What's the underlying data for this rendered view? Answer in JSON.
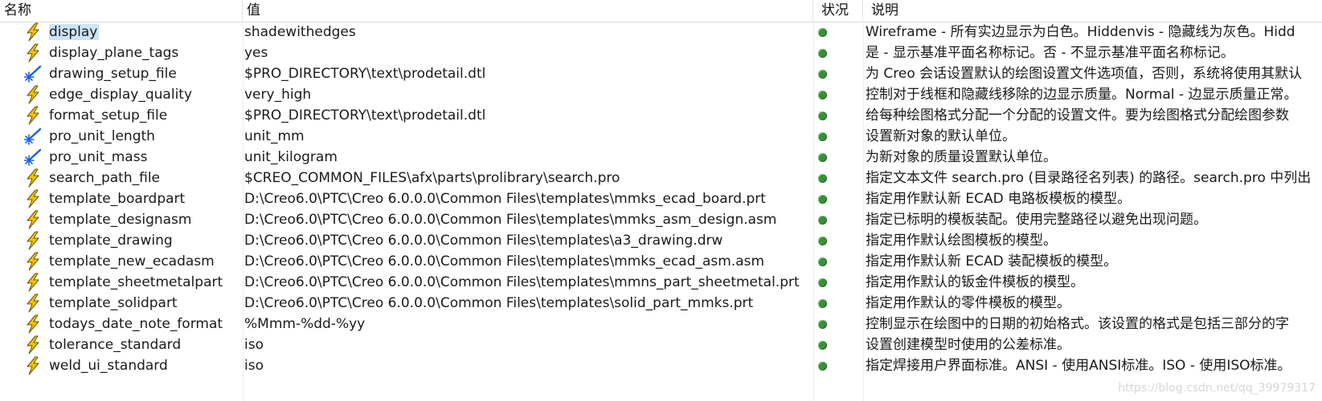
{
  "header": {
    "name": "名称",
    "value": "值",
    "status": "状况",
    "description": "说明"
  },
  "rows": [
    {
      "icon": "lightning-icon",
      "name": "display",
      "value": "shadewithedges",
      "status": "active",
      "description": "Wireframe - 所有实边显示为白色。Hiddenvis - 隐藏线为灰色。Hidd"
    },
    {
      "icon": "lightning-icon",
      "name": "display_plane_tags",
      "value": "yes",
      "status": "active",
      "description": "是 - 显示基准平面名称标记。否 - 不显示基准平面名称标记。"
    },
    {
      "icon": "star-wand-icon",
      "name": "drawing_setup_file",
      "value": "$PRO_DIRECTORY\\text\\prodetail.dtl",
      "status": "active",
      "description": "为 Creo 会话设置默认的绘图设置文件选项值，否则，系统将使用其默认"
    },
    {
      "icon": "lightning-icon",
      "name": "edge_display_quality",
      "value": "very_high",
      "status": "active",
      "description": "控制对于线框和隐藏线移除的边显示质量。Normal - 边显示质量正常。"
    },
    {
      "icon": "lightning-icon",
      "name": "format_setup_file",
      "value": "$PRO_DIRECTORY\\text\\prodetail.dtl",
      "status": "active",
      "description": "给每种绘图格式分配一个分配的设置文件。要为绘图格式分配绘图参数"
    },
    {
      "icon": "star-wand-icon",
      "name": "pro_unit_length",
      "value": "unit_mm",
      "status": "active",
      "description": "设置新对象的默认单位。"
    },
    {
      "icon": "star-wand-icon",
      "name": "pro_unit_mass",
      "value": "unit_kilogram",
      "status": "active",
      "description": "为新对象的质量设置默认单位。"
    },
    {
      "icon": "lightning-icon",
      "name": "search_path_file",
      "value": "$CREO_COMMON_FILES\\afx\\parts\\prolibrary\\search.pro",
      "status": "active",
      "description": "指定文本文件 search.pro (目录路径名列表) 的路径。search.pro 中列出"
    },
    {
      "icon": "lightning-icon",
      "name": "template_boardpart",
      "value": "D:\\Creo6.0\\PTC\\Creo 6.0.0.0\\Common Files\\templates\\mmks_ecad_board.prt",
      "status": "active",
      "description": "指定用作默认新 ECAD 电路板模板的模型。"
    },
    {
      "icon": "lightning-icon",
      "name": "template_designasm",
      "value": "D:\\Creo6.0\\PTC\\Creo 6.0.0.0\\Common Files\\templates\\mmks_asm_design.asm",
      "status": "active",
      "description": "指定已标明的模板装配。使用完整路径以避免出现问题。"
    },
    {
      "icon": "lightning-icon",
      "name": "template_drawing",
      "value": "D:\\Creo6.0\\PTC\\Creo 6.0.0.0\\Common Files\\templates\\a3_drawing.drw",
      "status": "active",
      "description": "指定用作默认绘图模板的模型。"
    },
    {
      "icon": "lightning-icon",
      "name": "template_new_ecadasm",
      "value": "D:\\Creo6.0\\PTC\\Creo 6.0.0.0\\Common Files\\templates\\mmks_ecad_asm.asm",
      "status": "active",
      "description": "指定用作默认新 ECAD 装配模板的模型。"
    },
    {
      "icon": "lightning-icon",
      "name": "template_sheetmetalpart",
      "value": "D:\\Creo6.0\\PTC\\Creo 6.0.0.0\\Common Files\\templates\\mmns_part_sheetmetal.prt",
      "status": "active",
      "description": "指定用作默认的钣金件模板的模型。"
    },
    {
      "icon": "lightning-icon",
      "name": "template_solidpart",
      "value": "D:\\Creo6.0\\PTC\\Creo 6.0.0.0\\Common Files\\templates\\solid_part_mmks.prt",
      "status": "active",
      "description": "指定用作默认的零件模板的模型。"
    },
    {
      "icon": "lightning-icon",
      "name": "todays_date_note_format",
      "value": "%Mmm-%dd-%yy",
      "status": "active",
      "description": "控制显示在绘图中的日期的初始格式。该设置的格式是包括三部分的字"
    },
    {
      "icon": "lightning-icon",
      "name": "tolerance_standard",
      "value": "iso",
      "status": "active",
      "description": "设置创建模型时使用的公差标准。"
    },
    {
      "icon": "lightning-icon",
      "name": "weld_ui_standard",
      "value": "iso",
      "status": "active",
      "description": "指定焊接用户界面标准。ANSI - 使用ANSI标准。ISO - 使用ISO标准。"
    }
  ],
  "selected_row": 0,
  "colors": {
    "status_active": "#3a8f3a",
    "selection": "#cce4f7",
    "lightning": "#f2c400",
    "star_wand": "#1f63d6"
  },
  "watermark": "https://blog.csdn.net/qq_39979317"
}
